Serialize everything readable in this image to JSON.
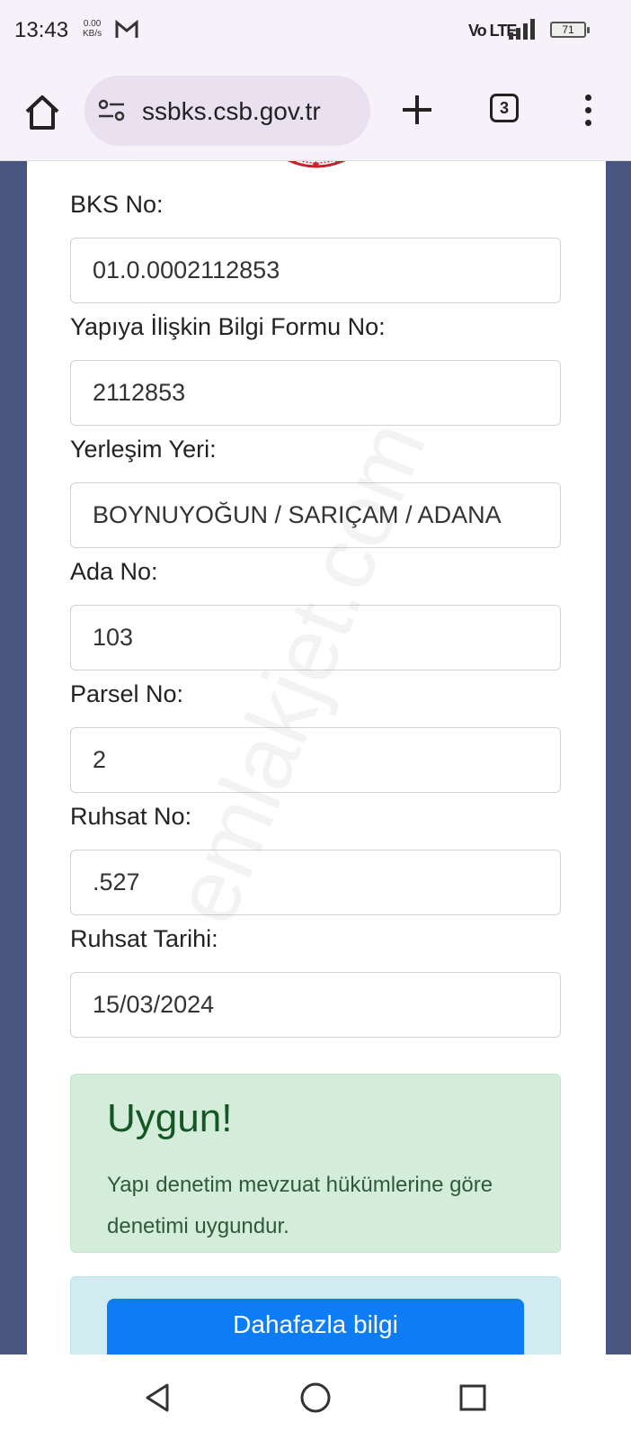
{
  "status_bar": {
    "time": "13:43",
    "net_speed_value": "0.00",
    "net_speed_unit": "KB/s",
    "network": "Vo LTE",
    "battery": "71"
  },
  "browser": {
    "url": "ssbks.csb.gov.tr",
    "tab_count": "3"
  },
  "form": {
    "fields": [
      {
        "label": "BKS No:",
        "value": "01.0.0002112853"
      },
      {
        "label": "Yapıya İlişkin Bilgi Formu No:",
        "value": "2112853"
      },
      {
        "label": "Yerleşim Yeri:",
        "value": "BOYNUYOĞUN / SARIÇAM / ADANA"
      },
      {
        "label": "Ada No:",
        "value": "103"
      },
      {
        "label": "Parsel No:",
        "value": "2"
      },
      {
        "label": "Ruhsat No:",
        "value": ".527"
      },
      {
        "label": "Ruhsat Tarihi:",
        "value": "15/03/2024"
      }
    ]
  },
  "result": {
    "title": "Uygun!",
    "message": "Yapı denetim mevzuat hükümlerine göre denetimi uygundur."
  },
  "action": {
    "button_label": "Dahafazla bilgi"
  },
  "watermark": "emlakjet.com",
  "colors": {
    "page_background": "#4a5680",
    "success_bg": "#d4edda",
    "success_text": "#155724",
    "info_bg": "#d1ecf1",
    "primary": "#0d7cf5"
  }
}
